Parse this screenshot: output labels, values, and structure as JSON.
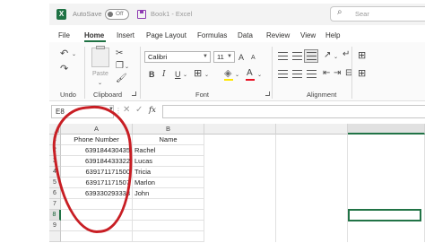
{
  "titlebar": {
    "logo_letter": "X",
    "autosave_label": "AutoSave",
    "toggle_state": "Off",
    "document_title": "Book1 - Excel",
    "search_placeholder": "Sear"
  },
  "menu": {
    "tabs": [
      {
        "label": "File",
        "active": false
      },
      {
        "label": "Home",
        "active": true
      },
      {
        "label": "Insert",
        "active": false
      },
      {
        "label": "Page Layout",
        "active": false
      },
      {
        "label": "Formulas",
        "active": false
      },
      {
        "label": "Data",
        "active": false
      },
      {
        "label": "Review",
        "active": false
      },
      {
        "label": "View",
        "active": false
      },
      {
        "label": "Help",
        "active": false
      }
    ]
  },
  "ribbon": {
    "undo_group": "Undo",
    "clipboard_group": "Clipboard",
    "paste_label": "Paste",
    "font_group": "Font",
    "alignment_group": "Alignment",
    "font_name": "Calibri",
    "font_size": "11",
    "bold": "B",
    "italic": "I",
    "underline": "U",
    "grow_font": "A",
    "shrink_font": "A",
    "font_color_letter": "A"
  },
  "formula_bar": {
    "name_box": "E8",
    "fx": "fx",
    "value": ""
  },
  "sheet": {
    "columns": [
      "A",
      "B"
    ],
    "rows": [
      "1",
      "2",
      "3",
      "4",
      "5",
      "6",
      "7",
      "8",
      "9"
    ],
    "active_cell": "E8",
    "data": [
      [
        "Phone Number",
        "Name"
      ],
      [
        "639184430435",
        "Rachel"
      ],
      [
        "639184433322",
        "Lucas"
      ],
      [
        "639171171500",
        "Tricia"
      ],
      [
        "639171171507",
        "Marlon"
      ],
      [
        "639330293333",
        "John"
      ],
      [
        "",
        ""
      ],
      [
        "",
        ""
      ],
      [
        "",
        ""
      ]
    ]
  },
  "colors": {
    "excel_green": "#217346",
    "annotation_red": "#c81e24"
  }
}
